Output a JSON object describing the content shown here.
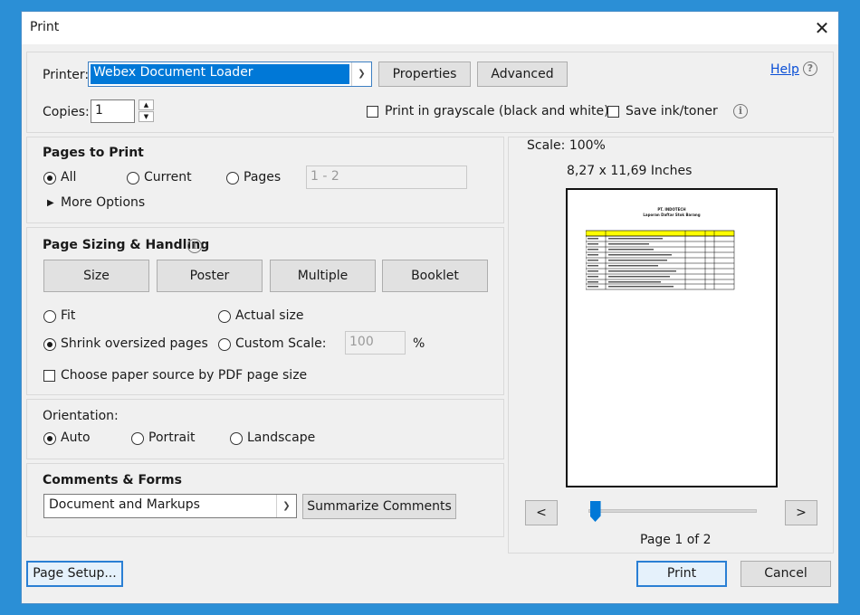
{
  "dialog": {
    "title": "Print",
    "close_glyph": "✕"
  },
  "printer": {
    "label": "Printer:",
    "value": "Webex Document Loader",
    "properties_label": "Properties",
    "advanced_label": "Advanced",
    "help_label": "Help"
  },
  "copies": {
    "label": "Copies:",
    "value": "1",
    "grayscale_label": "Print in grayscale (black and white)",
    "save_ink_label": "Save ink/toner"
  },
  "pages_to_print": {
    "heading": "Pages to Print",
    "all_label": "All",
    "current_label": "Current",
    "pages_label": "Pages",
    "pages_range": "1 - 2",
    "more_options": "More Options"
  },
  "sizing": {
    "heading": "Page Sizing & Handling",
    "tabs": [
      "Size",
      "Poster",
      "Multiple",
      "Booklet"
    ],
    "fit_label": "Fit",
    "actual_label": "Actual size",
    "shrink_label": "Shrink oversized pages",
    "custom_label": "Custom Scale:",
    "custom_value": "100",
    "percent": "%",
    "paper_source_label": "Choose paper source by PDF page size"
  },
  "orientation": {
    "heading": "Orientation:",
    "auto_label": "Auto",
    "portrait_label": "Portrait",
    "landscape_label": "Landscape"
  },
  "comments": {
    "heading": "Comments & Forms",
    "value": "Document and Markups",
    "summarize_label": "Summarize Comments"
  },
  "preview": {
    "scale": "Scale: 100%",
    "paper_size": "8,27 x 11,69 Inches",
    "doc_title_1": "PT. INDOTECH",
    "doc_title_2": "Laporan Daftar Stok Barang",
    "prev_label": "<",
    "next_label": ">",
    "page_status": "Page 1 of 2",
    "slider_progress": 0.02
  },
  "footer": {
    "page_setup_label": "Page Setup...",
    "print_label": "Print",
    "cancel_label": "Cancel"
  },
  "colors": {
    "desktop": "#2b8fd6",
    "accent": "#2a7fd4",
    "printer_highlight": "#0078d7",
    "header_yellow": "#ffff00"
  }
}
